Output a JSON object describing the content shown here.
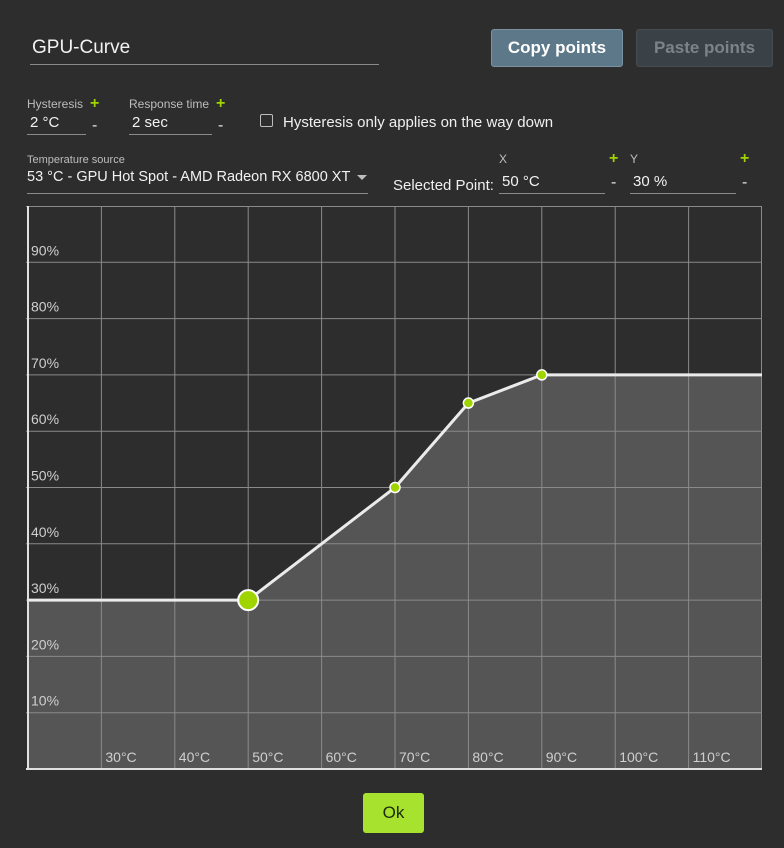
{
  "curve_name": "GPU-Curve",
  "buttons": {
    "copy": "Copy points",
    "paste": "Paste points",
    "ok": "Ok"
  },
  "hysteresis": {
    "label": "Hysteresis",
    "value": "2 °C",
    "plus": "+",
    "minus": "-"
  },
  "response_time": {
    "label": "Response time",
    "value": "2 sec",
    "plus": "+",
    "minus": "-"
  },
  "hysteresis_down": {
    "label": "Hysteresis only applies on the way down",
    "checked": false
  },
  "temperature_source": {
    "label": "Temperature source",
    "value": "53 °C - GPU Hot Spot - AMD Radeon RX 6800 XT"
  },
  "selected_point": {
    "label": "Selected Point:",
    "x_label": "X",
    "x_value": "50 °C",
    "y_label": "Y",
    "y_value": "30 %",
    "plus": "+",
    "minus": "-"
  },
  "colors": {
    "accent": "#9fd400",
    "fill": "#555555",
    "background": "#2d2d2d",
    "grid": "#8a8a8a"
  },
  "chart_data": {
    "type": "line",
    "x_tick_labels": [
      "30°C",
      "40°C",
      "50°C",
      "60°C",
      "70°C",
      "80°C",
      "90°C",
      "100°C",
      "110°C"
    ],
    "y_tick_labels": [
      "10%",
      "20%",
      "30%",
      "40%",
      "50%",
      "60%",
      "70%",
      "80%",
      "90%"
    ],
    "x_ticks": [
      30,
      40,
      50,
      60,
      70,
      80,
      90,
      100,
      110
    ],
    "y_ticks": [
      10,
      20,
      30,
      40,
      50,
      60,
      70,
      80,
      90
    ],
    "xlim": [
      20,
      120
    ],
    "ylim": [
      0,
      100
    ],
    "grid": true,
    "points": [
      {
        "x": 50,
        "y": 30
      },
      {
        "x": 70,
        "y": 50
      },
      {
        "x": 80,
        "y": 65
      },
      {
        "x": 90,
        "y": 70
      }
    ],
    "selected_point_index": 0
  }
}
